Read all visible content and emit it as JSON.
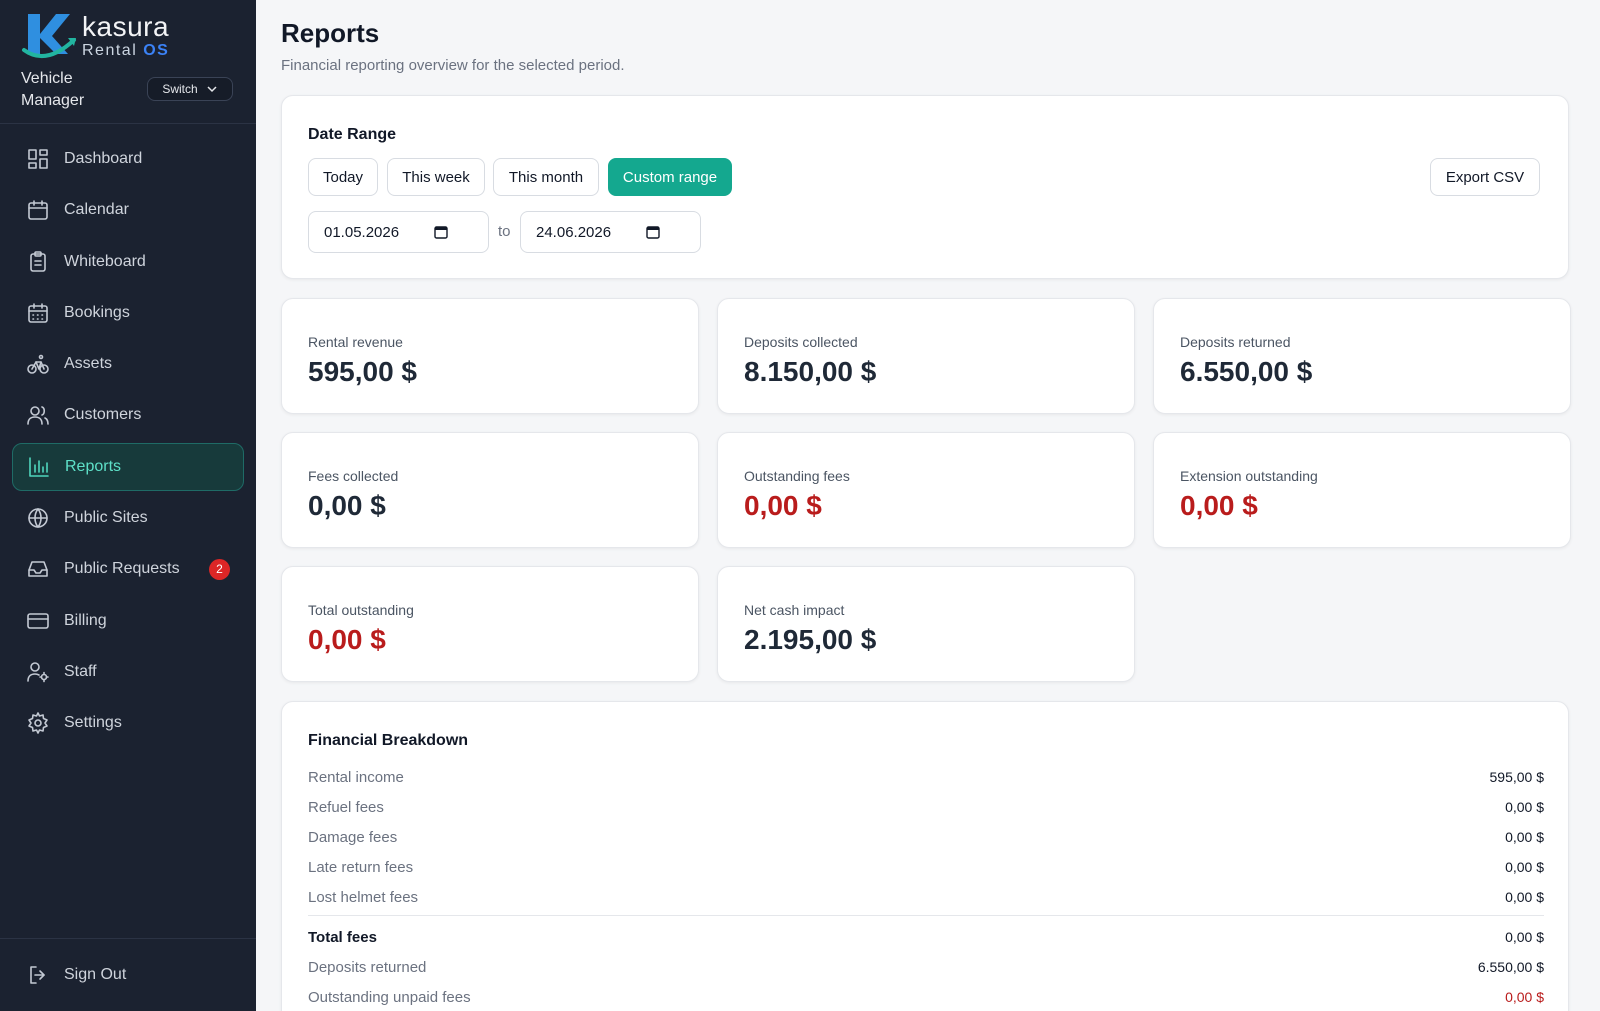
{
  "brand": {
    "name": "kasura",
    "sub": "Rental",
    "sub_os": "OS",
    "role": "Vehicle Manager",
    "switch_label": "Switch"
  },
  "nav": [
    {
      "label": "Dashboard",
      "icon": "dashboard-icon"
    },
    {
      "label": "Calendar",
      "icon": "calendar-icon"
    },
    {
      "label": "Whiteboard",
      "icon": "clipboard-icon"
    },
    {
      "label": "Bookings",
      "icon": "calendar-grid-icon"
    },
    {
      "label": "Assets",
      "icon": "bike-icon"
    },
    {
      "label": "Customers",
      "icon": "users-icon"
    },
    {
      "label": "Reports",
      "icon": "bar-chart-icon",
      "active": true
    },
    {
      "label": "Public Sites",
      "icon": "globe-icon"
    },
    {
      "label": "Public Requests",
      "icon": "inbox-icon",
      "badge": "2"
    },
    {
      "label": "Billing",
      "icon": "credit-card-icon"
    },
    {
      "label": "Staff",
      "icon": "user-cog-icon"
    },
    {
      "label": "Settings",
      "icon": "gear-icon"
    }
  ],
  "signout_label": "Sign Out",
  "page": {
    "title": "Reports",
    "subtitle": "Financial reporting overview for the selected period."
  },
  "date_range": {
    "title": "Date Range",
    "presets": [
      "Today",
      "This week",
      "This month",
      "Custom range"
    ],
    "active_preset": "Custom range",
    "export_label": "Export CSV",
    "from": "01.05.2026",
    "to_label": "to",
    "to": "24.06.2026"
  },
  "stats": [
    {
      "label": "Rental revenue",
      "value": "595,00 $",
      "negative": false
    },
    {
      "label": "Deposits collected",
      "value": "8.150,00 $",
      "negative": false
    },
    {
      "label": "Deposits returned",
      "value": "6.550,00 $",
      "negative": false
    },
    {
      "label": "Fees collected",
      "value": "0,00 $",
      "negative": false
    },
    {
      "label": "Outstanding fees",
      "value": "0,00 $",
      "negative": true
    },
    {
      "label": "Extension outstanding",
      "value": "0,00 $",
      "negative": true
    },
    {
      "label": "Total outstanding",
      "value": "0,00 $",
      "negative": true
    },
    {
      "label": "Net cash impact",
      "value": "2.195,00 $",
      "negative": false
    }
  ],
  "breakdown": {
    "title": "Financial Breakdown",
    "rows": [
      {
        "label": "Rental income",
        "amount": "595,00 $"
      },
      {
        "label": "Refuel fees",
        "amount": "0,00 $"
      },
      {
        "label": "Damage fees",
        "amount": "0,00 $"
      },
      {
        "label": "Late return fees",
        "amount": "0,00 $"
      },
      {
        "label": "Lost helmet fees",
        "amount": "0,00 $"
      }
    ],
    "total": {
      "label": "Total fees",
      "amount": "0,00 $"
    },
    "after": [
      {
        "label": "Deposits returned",
        "amount": "6.550,00 $"
      },
      {
        "label": "Outstanding unpaid fees",
        "amount": "0,00 $",
        "negative": true
      }
    ]
  },
  "colors": {
    "accent": "#14a88f",
    "sidebar": "#1b2230",
    "negative": "#b91c1c",
    "badge": "#dc2626"
  }
}
